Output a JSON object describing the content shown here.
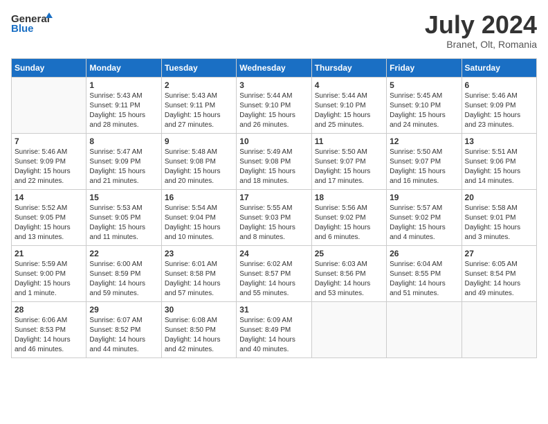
{
  "header": {
    "logo_general": "General",
    "logo_blue": "Blue",
    "month": "July 2024",
    "location": "Branet, Olt, Romania"
  },
  "weekdays": [
    "Sunday",
    "Monday",
    "Tuesday",
    "Wednesday",
    "Thursday",
    "Friday",
    "Saturday"
  ],
  "weeks": [
    [
      {
        "day": "",
        "info": ""
      },
      {
        "day": "1",
        "info": "Sunrise: 5:43 AM\nSunset: 9:11 PM\nDaylight: 15 hours\nand 28 minutes."
      },
      {
        "day": "2",
        "info": "Sunrise: 5:43 AM\nSunset: 9:11 PM\nDaylight: 15 hours\nand 27 minutes."
      },
      {
        "day": "3",
        "info": "Sunrise: 5:44 AM\nSunset: 9:10 PM\nDaylight: 15 hours\nand 26 minutes."
      },
      {
        "day": "4",
        "info": "Sunrise: 5:44 AM\nSunset: 9:10 PM\nDaylight: 15 hours\nand 25 minutes."
      },
      {
        "day": "5",
        "info": "Sunrise: 5:45 AM\nSunset: 9:10 PM\nDaylight: 15 hours\nand 24 minutes."
      },
      {
        "day": "6",
        "info": "Sunrise: 5:46 AM\nSunset: 9:09 PM\nDaylight: 15 hours\nand 23 minutes."
      }
    ],
    [
      {
        "day": "7",
        "info": "Sunrise: 5:46 AM\nSunset: 9:09 PM\nDaylight: 15 hours\nand 22 minutes."
      },
      {
        "day": "8",
        "info": "Sunrise: 5:47 AM\nSunset: 9:09 PM\nDaylight: 15 hours\nand 21 minutes."
      },
      {
        "day": "9",
        "info": "Sunrise: 5:48 AM\nSunset: 9:08 PM\nDaylight: 15 hours\nand 20 minutes."
      },
      {
        "day": "10",
        "info": "Sunrise: 5:49 AM\nSunset: 9:08 PM\nDaylight: 15 hours\nand 18 minutes."
      },
      {
        "day": "11",
        "info": "Sunrise: 5:50 AM\nSunset: 9:07 PM\nDaylight: 15 hours\nand 17 minutes."
      },
      {
        "day": "12",
        "info": "Sunrise: 5:50 AM\nSunset: 9:07 PM\nDaylight: 15 hours\nand 16 minutes."
      },
      {
        "day": "13",
        "info": "Sunrise: 5:51 AM\nSunset: 9:06 PM\nDaylight: 15 hours\nand 14 minutes."
      }
    ],
    [
      {
        "day": "14",
        "info": "Sunrise: 5:52 AM\nSunset: 9:05 PM\nDaylight: 15 hours\nand 13 minutes."
      },
      {
        "day": "15",
        "info": "Sunrise: 5:53 AM\nSunset: 9:05 PM\nDaylight: 15 hours\nand 11 minutes."
      },
      {
        "day": "16",
        "info": "Sunrise: 5:54 AM\nSunset: 9:04 PM\nDaylight: 15 hours\nand 10 minutes."
      },
      {
        "day": "17",
        "info": "Sunrise: 5:55 AM\nSunset: 9:03 PM\nDaylight: 15 hours\nand 8 minutes."
      },
      {
        "day": "18",
        "info": "Sunrise: 5:56 AM\nSunset: 9:02 PM\nDaylight: 15 hours\nand 6 minutes."
      },
      {
        "day": "19",
        "info": "Sunrise: 5:57 AM\nSunset: 9:02 PM\nDaylight: 15 hours\nand 4 minutes."
      },
      {
        "day": "20",
        "info": "Sunrise: 5:58 AM\nSunset: 9:01 PM\nDaylight: 15 hours\nand 3 minutes."
      }
    ],
    [
      {
        "day": "21",
        "info": "Sunrise: 5:59 AM\nSunset: 9:00 PM\nDaylight: 15 hours\nand 1 minute."
      },
      {
        "day": "22",
        "info": "Sunrise: 6:00 AM\nSunset: 8:59 PM\nDaylight: 14 hours\nand 59 minutes."
      },
      {
        "day": "23",
        "info": "Sunrise: 6:01 AM\nSunset: 8:58 PM\nDaylight: 14 hours\nand 57 minutes."
      },
      {
        "day": "24",
        "info": "Sunrise: 6:02 AM\nSunset: 8:57 PM\nDaylight: 14 hours\nand 55 minutes."
      },
      {
        "day": "25",
        "info": "Sunrise: 6:03 AM\nSunset: 8:56 PM\nDaylight: 14 hours\nand 53 minutes."
      },
      {
        "day": "26",
        "info": "Sunrise: 6:04 AM\nSunset: 8:55 PM\nDaylight: 14 hours\nand 51 minutes."
      },
      {
        "day": "27",
        "info": "Sunrise: 6:05 AM\nSunset: 8:54 PM\nDaylight: 14 hours\nand 49 minutes."
      }
    ],
    [
      {
        "day": "28",
        "info": "Sunrise: 6:06 AM\nSunset: 8:53 PM\nDaylight: 14 hours\nand 46 minutes."
      },
      {
        "day": "29",
        "info": "Sunrise: 6:07 AM\nSunset: 8:52 PM\nDaylight: 14 hours\nand 44 minutes."
      },
      {
        "day": "30",
        "info": "Sunrise: 6:08 AM\nSunset: 8:50 PM\nDaylight: 14 hours\nand 42 minutes."
      },
      {
        "day": "31",
        "info": "Sunrise: 6:09 AM\nSunset: 8:49 PM\nDaylight: 14 hours\nand 40 minutes."
      },
      {
        "day": "",
        "info": ""
      },
      {
        "day": "",
        "info": ""
      },
      {
        "day": "",
        "info": ""
      }
    ]
  ]
}
